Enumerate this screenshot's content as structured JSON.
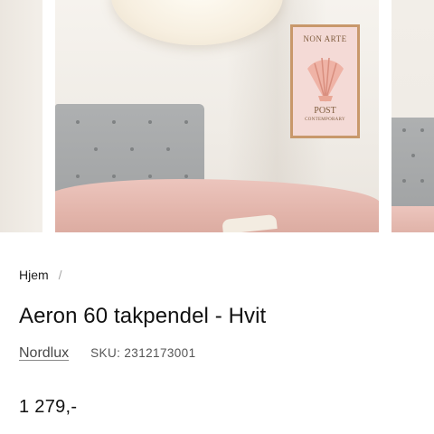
{
  "gallery": {
    "poster": {
      "line1": "NON ARTE",
      "line2": "POST",
      "line3": "CONTEMPORARY"
    },
    "zoom_icon": "magnifier-icon"
  },
  "breadcrumb": {
    "home_label": "Hjem",
    "separator": "/"
  },
  "product": {
    "title": "Aeron 60 takpendel - Hvit",
    "brand": "Nordlux",
    "sku": "SKU: 2312173001",
    "price": "1 279,-"
  }
}
